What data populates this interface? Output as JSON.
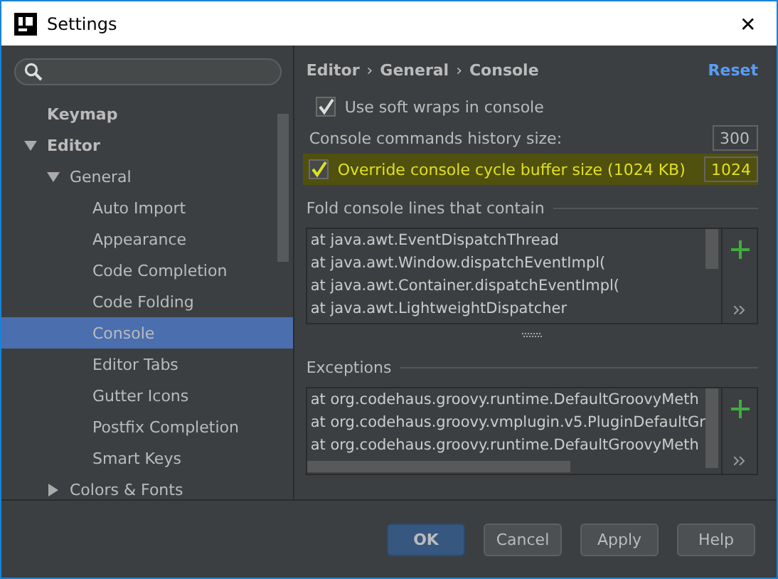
{
  "window": {
    "title": "Settings",
    "close": "✕"
  },
  "tree": [
    {
      "label": "Keymap",
      "selected": false
    },
    {
      "label": "Editor",
      "selected": false,
      "expanded": true,
      "children": [
        {
          "label": "General",
          "selected": false,
          "expanded": true,
          "children": [
            {
              "label": "Auto Import",
              "selected": false
            },
            {
              "label": "Appearance",
              "selected": false
            },
            {
              "label": "Code Completion",
              "selected": false
            },
            {
              "label": "Code Folding",
              "selected": false
            },
            {
              "label": "Console",
              "selected": true
            },
            {
              "label": "Editor Tabs",
              "selected": false
            },
            {
              "label": "Gutter Icons",
              "selected": false
            },
            {
              "label": "Postfix Completion",
              "selected": false
            },
            {
              "label": "Smart Keys",
              "selected": false
            }
          ]
        },
        {
          "label": "Colors & Fonts",
          "selected": false,
          "expanded": false
        }
      ]
    }
  ],
  "breadcrumb": [
    "Editor",
    "General",
    "Console"
  ],
  "breadcrumb_separator": "›",
  "reset": "Reset",
  "options": [
    {
      "kind": "checkbox",
      "label": "Use soft wraps in console",
      "checked": true,
      "highlighted": false
    },
    {
      "kind": "number",
      "label": "Console commands history size:",
      "value": "300",
      "highlighted": false
    },
    {
      "kind": "checkbox-number",
      "label": "Override console cycle buffer size (1024 KB)",
      "checked": true,
      "value": "1024",
      "highlighted": true
    }
  ],
  "fold": {
    "title": "Fold console lines that contain",
    "lines": [
      "at java.awt.EventDispatchThread",
      "at java.awt.Window.dispatchEventImpl(",
      "at java.awt.Container.dispatchEventImpl(",
      "at java.awt.LightweightDispatcher"
    ]
  },
  "exceptions": {
    "title": "Exceptions",
    "lines": [
      "at org.codehaus.groovy.runtime.DefaultGroovyMeth",
      "at org.codehaus.groovy.vmplugin.v5.PluginDefaultGr",
      "at org.codehaus.groovy.runtime.DefaultGroovyMeth"
    ]
  },
  "buttons": [
    {
      "label": "OK",
      "default": true
    },
    {
      "label": "Cancel",
      "default": false
    },
    {
      "label": "Apply",
      "default": false
    },
    {
      "label": "Help",
      "default": false
    }
  ]
}
